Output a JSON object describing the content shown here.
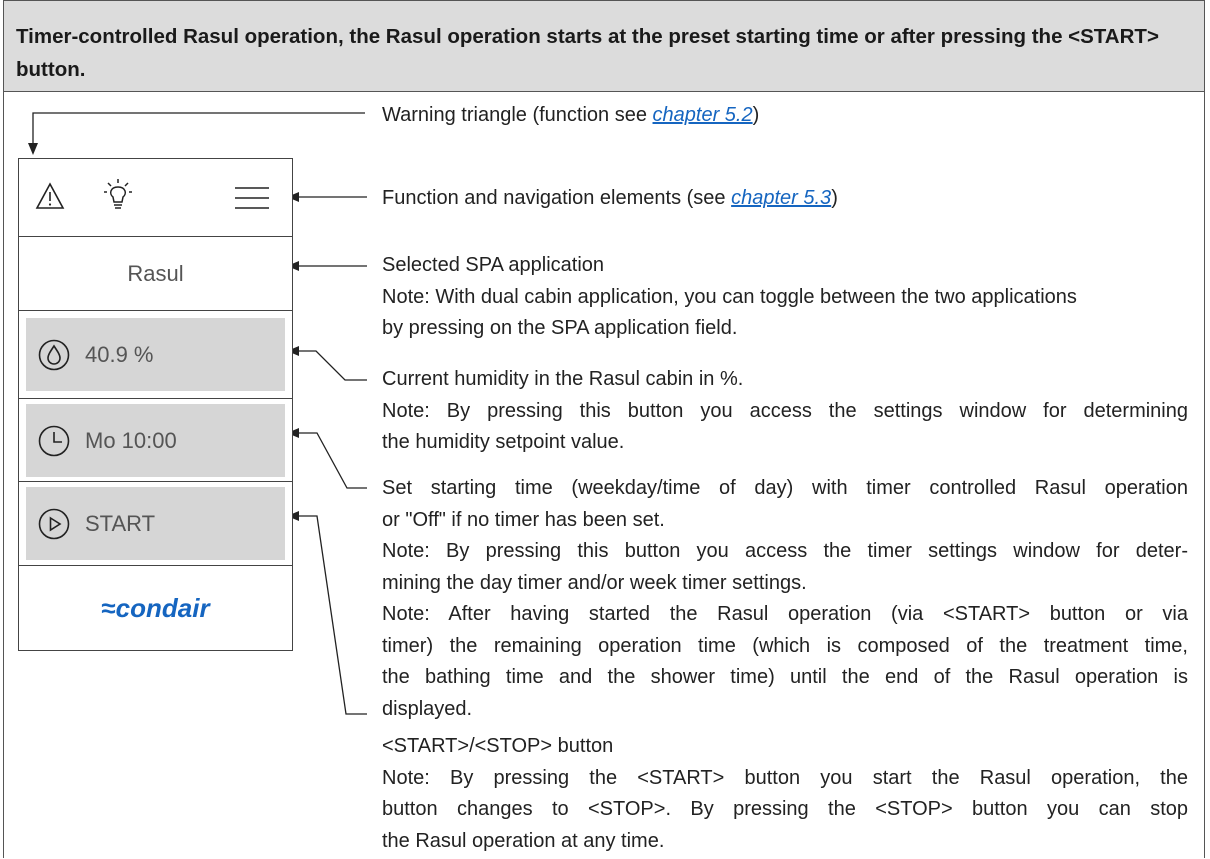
{
  "header": {
    "title": "Timer-controlled Rasul operation, the Rasul operation starts at the preset starting time or after pressing the <START> button."
  },
  "device": {
    "app_name": "Rasul",
    "humidity_value": "40.9 %",
    "timer_value": "Mo 10:00",
    "start_label": "START",
    "logo_text": "condair",
    "brand_color": "#1565c0",
    "icons": [
      "warning-icon",
      "light-bulb-icon",
      "menu-icon",
      "humidity-drop-icon",
      "clock-icon",
      "play-icon"
    ]
  },
  "descriptions": {
    "warning": {
      "pre": "Warning triangle (function see ",
      "ref": "chapter 5.2",
      "post": ")"
    },
    "function": {
      "pre": "Function and navigation elements (see ",
      "ref": "chapter 5.3",
      "post": ")"
    },
    "spa": {
      "title": "Selected SPA application",
      "note_l1": "Note: With dual cabin application, you can toggle between the two applications",
      "note_l2": "by pressing on the SPA application field."
    },
    "humidity": {
      "title": "Current humidity in the Rasul cabin in %.",
      "note_l1": "Note: By pressing this button you access the settings window for determining",
      "note_l2": "the humidity setpoint value."
    },
    "timer": {
      "l1": "Set starting time (weekday/time of day) with timer controlled Rasul operation",
      "l2": "or \"Off\" if no timer has been set.",
      "l3": "Note: By pressing this button you access the timer settings window for deter-",
      "l4": "mining the day timer and/or week timer settings.",
      "l5": "Note: After having started the Rasul operation (via <START> button or via",
      "l6": "timer) the remaining operation time (which is composed of the treatment time,",
      "l7": "the bathing time and the shower time) until the end of the Rasul operation is",
      "l8": "displayed."
    },
    "startstop": {
      "title": "<START>/<STOP> button",
      "l1": "Note: By pressing the <START> button you start the Rasul operation, the",
      "l2": "button changes to <STOP>. By pressing the <STOP> button you can stop",
      "l3": "the Rasul operation at any time."
    }
  }
}
